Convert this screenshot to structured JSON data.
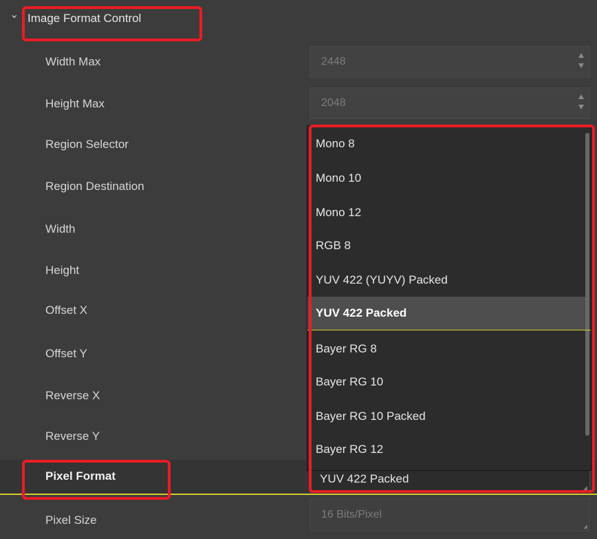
{
  "section": {
    "title": "Image Format Control",
    "chevron_icon": "chevron-down-icon"
  },
  "rows": [
    {
      "label": "Width Max",
      "value": "2448"
    },
    {
      "label": "Height Max",
      "value": "2048"
    },
    {
      "label": "Region Selector"
    },
    {
      "label": "Region Destination"
    },
    {
      "label": "Width"
    },
    {
      "label": "Height"
    },
    {
      "label": "Offset X"
    },
    {
      "label": "Offset Y"
    },
    {
      "label": "Reverse X"
    },
    {
      "label": "Reverse Y"
    },
    {
      "label": "Pixel Format",
      "value": "YUV 422 Packed"
    },
    {
      "label": "Pixel Size",
      "value": "16 Bits/Pixel"
    }
  ],
  "pixel_format_options": [
    "Mono 8",
    "Mono 10",
    "Mono 12",
    "RGB 8",
    "YUV 422 (YUYV) Packed",
    "YUV 422 Packed",
    "Bayer RG 8",
    "Bayer RG 10",
    "Bayer RG 10 Packed",
    "Bayer RG 12"
  ],
  "highlighted_option": "YUV 422 Packed",
  "colors": {
    "highlight_outline": "#ec1c24",
    "focus_underline": "#d8cc2b",
    "panel_bg": "#3c3c3c"
  }
}
